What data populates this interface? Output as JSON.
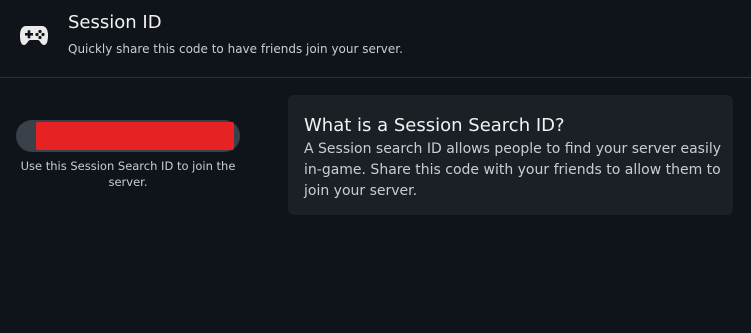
{
  "header": {
    "icon": "gamepad-icon",
    "title": "Session ID",
    "subtitle": "Quickly share this code to have friends join your server."
  },
  "session": {
    "redaction_color": "#e62222",
    "hint": "Use this Session Search ID to join the server."
  },
  "info": {
    "title": "What is a Session Search ID?",
    "body": "A Session search ID allows people to find your server easily in-game. Share this code with your friends to allow them to join your server."
  },
  "colors": {
    "background": "#0f141b",
    "card": "#1b2026",
    "pill": "#3a414a"
  }
}
